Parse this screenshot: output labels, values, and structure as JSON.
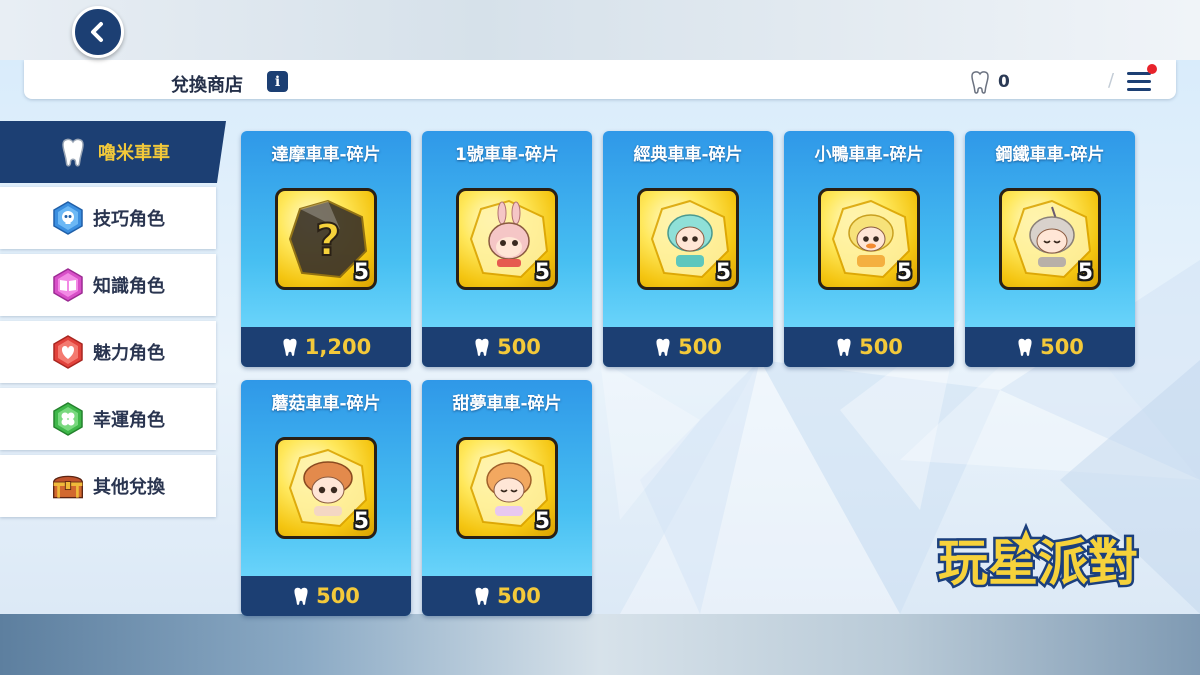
{
  "header": {
    "title": "兌換商店",
    "info_icon": "i",
    "currency_icon": "tooth-icon",
    "currency_value": "0",
    "separator": "/",
    "notification_color": "#e8232b"
  },
  "sidebar": {
    "items": [
      {
        "label": "嚕米車車",
        "icon": "tooth-icon",
        "active": true
      },
      {
        "label": "技巧角色",
        "icon": "skull-hexagon-icon",
        "active": false
      },
      {
        "label": "知識角色",
        "icon": "book-hexagon-icon",
        "active": false
      },
      {
        "label": "魅力角色",
        "icon": "heart-hexagon-icon",
        "active": false
      },
      {
        "label": "幸運角色",
        "icon": "clover-hexagon-icon",
        "active": false
      },
      {
        "label": "其他兌換",
        "icon": "treasure-chest-icon",
        "active": false
      }
    ]
  },
  "shop": {
    "items": [
      {
        "name": "達摩車車-碎片",
        "qty": "5",
        "price": "1,200",
        "mystery": true,
        "tint": "#555555"
      },
      {
        "name": "1號車車-碎片",
        "qty": "5",
        "price": "500",
        "mystery": false,
        "tint": "#f5c6c6"
      },
      {
        "name": "經典車車-碎片",
        "qty": "5",
        "price": "500",
        "mystery": false,
        "tint": "#8fe0d8"
      },
      {
        "name": "小鴨車車-碎片",
        "qty": "5",
        "price": "500",
        "mystery": false,
        "tint": "#f7e27a"
      },
      {
        "name": "鋼鐵車車-碎片",
        "qty": "5",
        "price": "500",
        "mystery": false,
        "tint": "#d9d2cc"
      },
      {
        "name": "蘑菇車車-碎片",
        "qty": "5",
        "price": "500",
        "mystery": false,
        "tint": "#f4d7c4"
      },
      {
        "name": "甜夢車車-碎片",
        "qty": "5",
        "price": "500",
        "mystery": false,
        "tint": "#e8c8f0"
      }
    ]
  },
  "logo": {
    "text": "玩星派對"
  },
  "colors": {
    "navy": "#1c3f73",
    "gold": "#f3c93a",
    "card_blue": "#47bff2"
  }
}
